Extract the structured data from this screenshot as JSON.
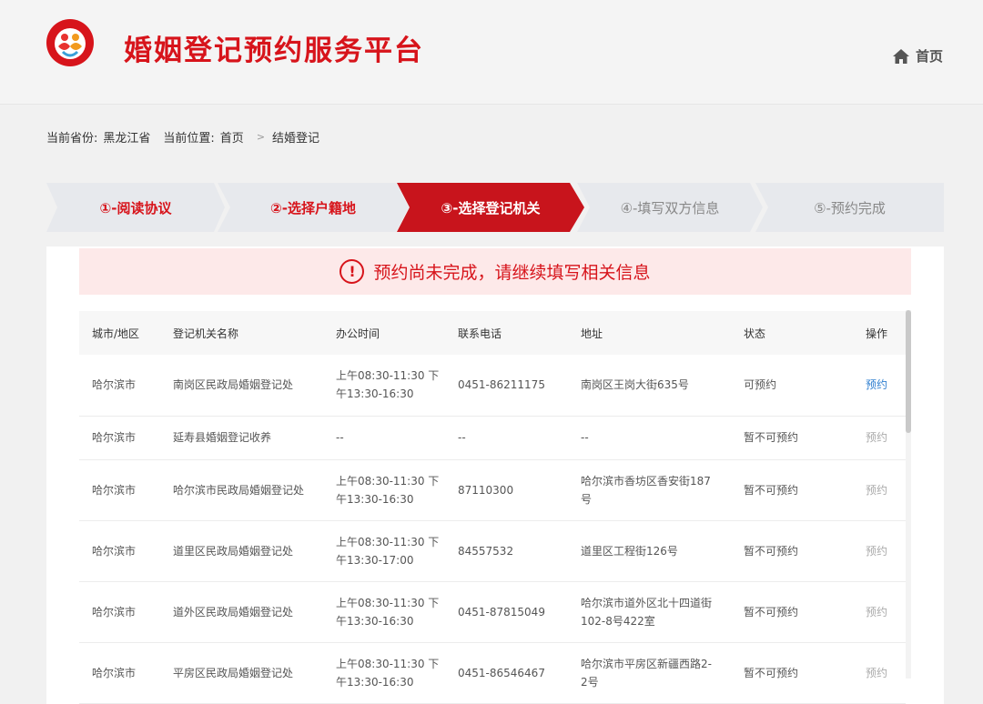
{
  "header": {
    "logo_text": "婚姻登记",
    "title": "婚姻登记预约服务平台",
    "home_label": "首页"
  },
  "breadcrumb": {
    "province_label": "当前省份:",
    "province": "黑龙江省",
    "location_label": "当前位置:",
    "home": "首页",
    "separator": ">",
    "current": "结婚登记"
  },
  "steps": [
    {
      "label": "①-阅读协议",
      "state": "done"
    },
    {
      "label": "②-选择户籍地",
      "state": "done"
    },
    {
      "label": "③-选择登记机关",
      "state": "active"
    },
    {
      "label": "④-填写双方信息",
      "state": "future"
    },
    {
      "label": "⑤-预约完成",
      "state": "future"
    }
  ],
  "alert": {
    "icon": "!",
    "message": "预约尚未完成，请继续填写相关信息"
  },
  "table": {
    "headers": [
      "城市/地区",
      "登记机关名称",
      "办公时间",
      "联系电话",
      "地址",
      "状态",
      "操作"
    ],
    "rows": [
      {
        "city": "哈尔滨市",
        "name": "南岗区民政局婚姻登记处",
        "hours1": "上午08:30-11:30 下",
        "hours2": "午13:30-16:30",
        "phone": "0451-86211175",
        "addr1": "南岗区王岗大街635号",
        "addr2": "",
        "status": "可预约",
        "op": "预约",
        "enabled": true
      },
      {
        "city": "哈尔滨市",
        "name": "延寿县婚姻登记收养",
        "hours1": "--",
        "hours2": "",
        "phone": "--",
        "addr1": "--",
        "addr2": "",
        "status": "暂不可预约",
        "op": "预约",
        "enabled": false
      },
      {
        "city": "哈尔滨市",
        "name": "哈尔滨市民政局婚姻登记处",
        "hours1": "上午08:30-11:30 下",
        "hours2": "午13:30-16:30",
        "phone": "87110300",
        "addr1": "哈尔滨市香坊区香安街187",
        "addr2": "号",
        "status": "暂不可预约",
        "op": "预约",
        "enabled": false
      },
      {
        "city": "哈尔滨市",
        "name": "道里区民政局婚姻登记处",
        "hours1": "上午08:30-11:30 下",
        "hours2": "午13:30-17:00",
        "phone": "84557532",
        "addr1": "道里区工程街126号",
        "addr2": "",
        "status": "暂不可预约",
        "op": "预约",
        "enabled": false
      },
      {
        "city": "哈尔滨市",
        "name": "道外区民政局婚姻登记处",
        "hours1": "上午08:30-11:30 下",
        "hours2": "午13:30-16:30",
        "phone": "0451-87815049",
        "addr1": "哈尔滨市道外区北十四道街",
        "addr2": "102-8号422室",
        "status": "暂不可预约",
        "op": "预约",
        "enabled": false
      },
      {
        "city": "哈尔滨市",
        "name": "平房区民政局婚姻登记处",
        "hours1": "上午08:30-11:30 下",
        "hours2": "午13:30-16:30",
        "phone": "0451-86546467",
        "addr1": "哈尔滨市平房区新疆西路2-",
        "addr2": "2号",
        "status": "暂不可预约",
        "op": "预约",
        "enabled": false
      }
    ]
  },
  "colors": {
    "brand_red": "#d7141b",
    "active_step": "#c8141c",
    "link_blue": "#2f7fd0",
    "alert_bg": "#fde9e9"
  }
}
